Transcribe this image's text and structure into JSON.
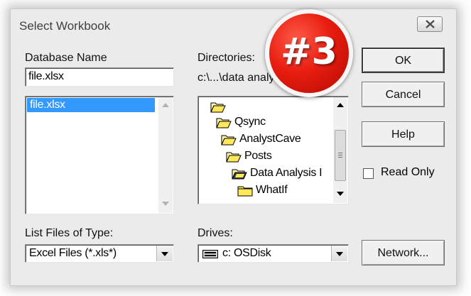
{
  "dialog": {
    "title": "Select Workbook",
    "close_icon": "close-x-icon"
  },
  "database": {
    "label": "Database Name",
    "value": "file.xlsx",
    "list": [
      {
        "label": "file.xlsx",
        "selected": true
      }
    ]
  },
  "directories": {
    "label": "Directories:",
    "path": "c:\\...\\data analy",
    "tree": [
      {
        "label": "",
        "icon": "folder-open-icon"
      },
      {
        "label": "Qsync",
        "icon": "folder-open-icon"
      },
      {
        "label": "AnalystCave",
        "icon": "folder-open-icon"
      },
      {
        "label": "Posts",
        "icon": "folder-open-icon"
      },
      {
        "label": "Data Analysis I",
        "icon": "folder-open-icon"
      },
      {
        "label": "WhatIf",
        "icon": "folder-closed-icon"
      }
    ]
  },
  "file_type": {
    "label": "List Files of Type:",
    "value": "Excel Files (*.xls*)"
  },
  "drives": {
    "label": "Drives:",
    "value": "c: OSDisk",
    "icon": "hard-drive-icon"
  },
  "buttons": {
    "ok": "OK",
    "cancel": "Cancel",
    "help": "Help",
    "network": "Network..."
  },
  "read_only": {
    "label": "Read Only",
    "checked": false
  },
  "badge": {
    "text": "#3",
    "color": "#e81d10"
  }
}
